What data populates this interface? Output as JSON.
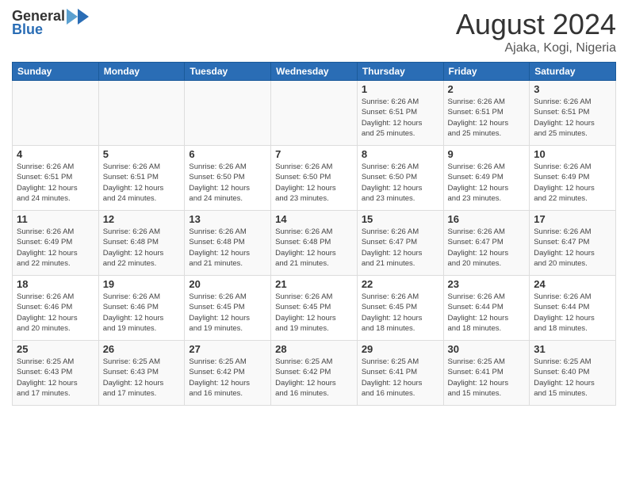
{
  "header": {
    "logo_general": "General",
    "logo_blue": "Blue",
    "month_title": "August 2024",
    "location": "Ajaka, Kogi, Nigeria"
  },
  "weekdays": [
    "Sunday",
    "Monday",
    "Tuesday",
    "Wednesday",
    "Thursday",
    "Friday",
    "Saturday"
  ],
  "weeks": [
    [
      {
        "day": "",
        "info": ""
      },
      {
        "day": "",
        "info": ""
      },
      {
        "day": "",
        "info": ""
      },
      {
        "day": "",
        "info": ""
      },
      {
        "day": "1",
        "info": "Sunrise: 6:26 AM\nSunset: 6:51 PM\nDaylight: 12 hours\nand 25 minutes."
      },
      {
        "day": "2",
        "info": "Sunrise: 6:26 AM\nSunset: 6:51 PM\nDaylight: 12 hours\nand 25 minutes."
      },
      {
        "day": "3",
        "info": "Sunrise: 6:26 AM\nSunset: 6:51 PM\nDaylight: 12 hours\nand 25 minutes."
      }
    ],
    [
      {
        "day": "4",
        "info": "Sunrise: 6:26 AM\nSunset: 6:51 PM\nDaylight: 12 hours\nand 24 minutes."
      },
      {
        "day": "5",
        "info": "Sunrise: 6:26 AM\nSunset: 6:51 PM\nDaylight: 12 hours\nand 24 minutes."
      },
      {
        "day": "6",
        "info": "Sunrise: 6:26 AM\nSunset: 6:50 PM\nDaylight: 12 hours\nand 24 minutes."
      },
      {
        "day": "7",
        "info": "Sunrise: 6:26 AM\nSunset: 6:50 PM\nDaylight: 12 hours\nand 23 minutes."
      },
      {
        "day": "8",
        "info": "Sunrise: 6:26 AM\nSunset: 6:50 PM\nDaylight: 12 hours\nand 23 minutes."
      },
      {
        "day": "9",
        "info": "Sunrise: 6:26 AM\nSunset: 6:49 PM\nDaylight: 12 hours\nand 23 minutes."
      },
      {
        "day": "10",
        "info": "Sunrise: 6:26 AM\nSunset: 6:49 PM\nDaylight: 12 hours\nand 22 minutes."
      }
    ],
    [
      {
        "day": "11",
        "info": "Sunrise: 6:26 AM\nSunset: 6:49 PM\nDaylight: 12 hours\nand 22 minutes."
      },
      {
        "day": "12",
        "info": "Sunrise: 6:26 AM\nSunset: 6:48 PM\nDaylight: 12 hours\nand 22 minutes."
      },
      {
        "day": "13",
        "info": "Sunrise: 6:26 AM\nSunset: 6:48 PM\nDaylight: 12 hours\nand 21 minutes."
      },
      {
        "day": "14",
        "info": "Sunrise: 6:26 AM\nSunset: 6:48 PM\nDaylight: 12 hours\nand 21 minutes."
      },
      {
        "day": "15",
        "info": "Sunrise: 6:26 AM\nSunset: 6:47 PM\nDaylight: 12 hours\nand 21 minutes."
      },
      {
        "day": "16",
        "info": "Sunrise: 6:26 AM\nSunset: 6:47 PM\nDaylight: 12 hours\nand 20 minutes."
      },
      {
        "day": "17",
        "info": "Sunrise: 6:26 AM\nSunset: 6:47 PM\nDaylight: 12 hours\nand 20 minutes."
      }
    ],
    [
      {
        "day": "18",
        "info": "Sunrise: 6:26 AM\nSunset: 6:46 PM\nDaylight: 12 hours\nand 20 minutes."
      },
      {
        "day": "19",
        "info": "Sunrise: 6:26 AM\nSunset: 6:46 PM\nDaylight: 12 hours\nand 19 minutes."
      },
      {
        "day": "20",
        "info": "Sunrise: 6:26 AM\nSunset: 6:45 PM\nDaylight: 12 hours\nand 19 minutes."
      },
      {
        "day": "21",
        "info": "Sunrise: 6:26 AM\nSunset: 6:45 PM\nDaylight: 12 hours\nand 19 minutes."
      },
      {
        "day": "22",
        "info": "Sunrise: 6:26 AM\nSunset: 6:45 PM\nDaylight: 12 hours\nand 18 minutes."
      },
      {
        "day": "23",
        "info": "Sunrise: 6:26 AM\nSunset: 6:44 PM\nDaylight: 12 hours\nand 18 minutes."
      },
      {
        "day": "24",
        "info": "Sunrise: 6:26 AM\nSunset: 6:44 PM\nDaylight: 12 hours\nand 18 minutes."
      }
    ],
    [
      {
        "day": "25",
        "info": "Sunrise: 6:25 AM\nSunset: 6:43 PM\nDaylight: 12 hours\nand 17 minutes."
      },
      {
        "day": "26",
        "info": "Sunrise: 6:25 AM\nSunset: 6:43 PM\nDaylight: 12 hours\nand 17 minutes."
      },
      {
        "day": "27",
        "info": "Sunrise: 6:25 AM\nSunset: 6:42 PM\nDaylight: 12 hours\nand 16 minutes."
      },
      {
        "day": "28",
        "info": "Sunrise: 6:25 AM\nSunset: 6:42 PM\nDaylight: 12 hours\nand 16 minutes."
      },
      {
        "day": "29",
        "info": "Sunrise: 6:25 AM\nSunset: 6:41 PM\nDaylight: 12 hours\nand 16 minutes."
      },
      {
        "day": "30",
        "info": "Sunrise: 6:25 AM\nSunset: 6:41 PM\nDaylight: 12 hours\nand 15 minutes."
      },
      {
        "day": "31",
        "info": "Sunrise: 6:25 AM\nSunset: 6:40 PM\nDaylight: 12 hours\nand 15 minutes."
      }
    ]
  ]
}
